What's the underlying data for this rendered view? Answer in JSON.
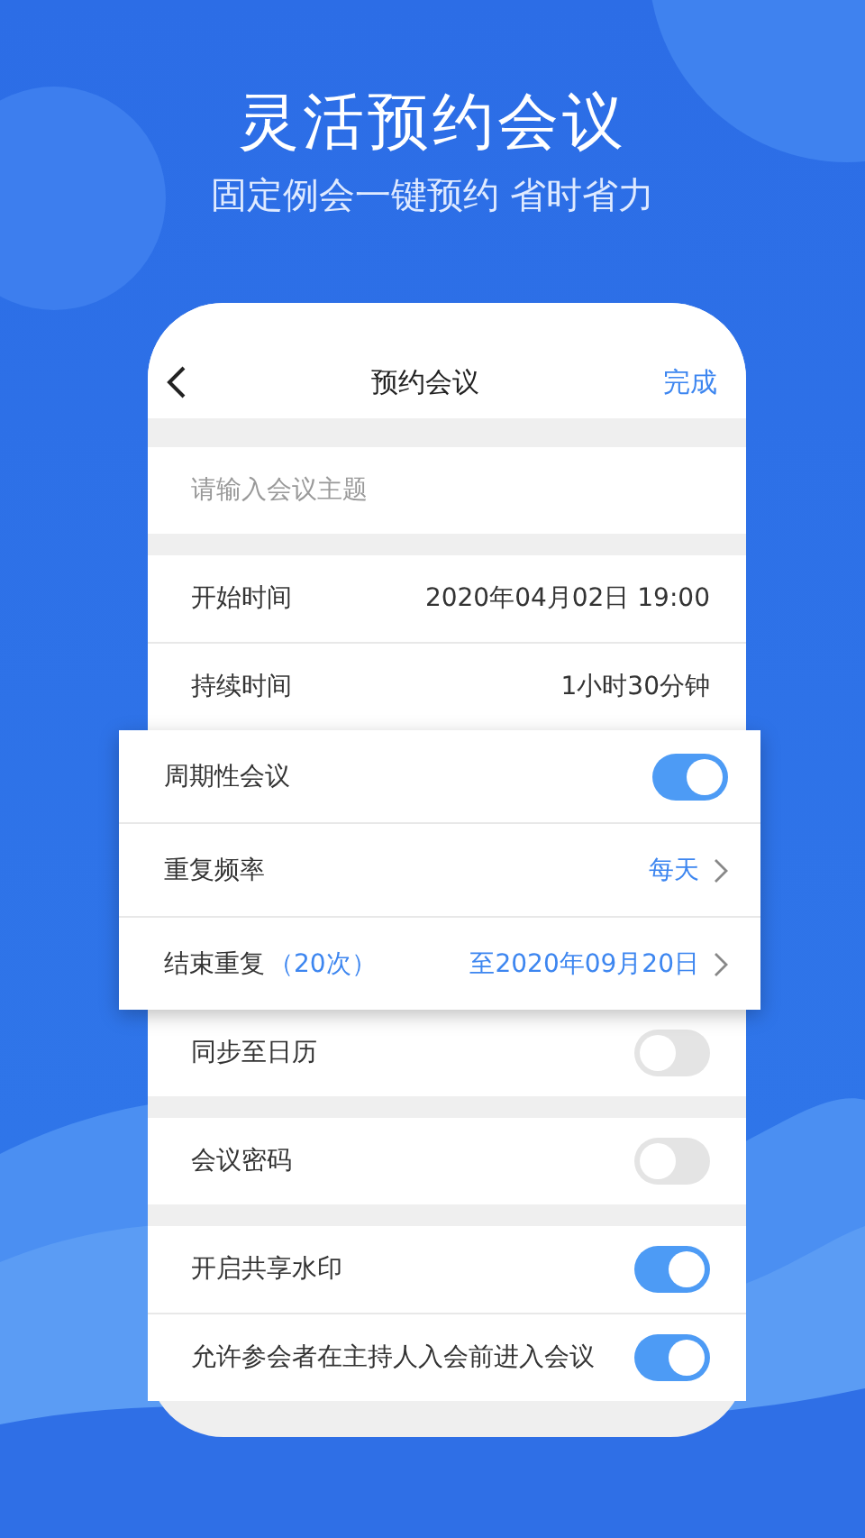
{
  "headline": "灵活预约会议",
  "subheadline": "固定例会一键预约 省时省力",
  "phone": {
    "header": {
      "title": "预约会议",
      "action": "完成"
    },
    "subject_field": {
      "placeholder": "请输入会议主题"
    },
    "sections": [
      {
        "raised": false,
        "rows": [
          {
            "kind": "value",
            "label": "开始时间",
            "value": "2020年04月02日 19:00"
          },
          {
            "kind": "value",
            "label": "持续时间",
            "value": "1小时30分钟"
          }
        ]
      },
      {
        "raised": true,
        "rows": [
          {
            "kind": "toggle",
            "label": "周期性会议",
            "on": true
          },
          {
            "kind": "link",
            "label": "重复频率",
            "value": "每天"
          },
          {
            "kind": "link",
            "label": "结束重复",
            "note": "（20次）",
            "value": "至2020年09月20日"
          }
        ]
      },
      {
        "raised": false,
        "rows": [
          {
            "kind": "toggle",
            "label": "同步至日历",
            "on": false
          }
        ]
      },
      {
        "raised": false,
        "rows": [
          {
            "kind": "toggle",
            "label": "会议密码",
            "on": false
          }
        ]
      },
      {
        "raised": false,
        "rows": [
          {
            "kind": "toggle",
            "label": "开启共享水印",
            "on": true
          },
          {
            "kind": "toggle",
            "label": "允许参会者在主持人入会前进入会议",
            "on": true
          }
        ]
      }
    ]
  }
}
